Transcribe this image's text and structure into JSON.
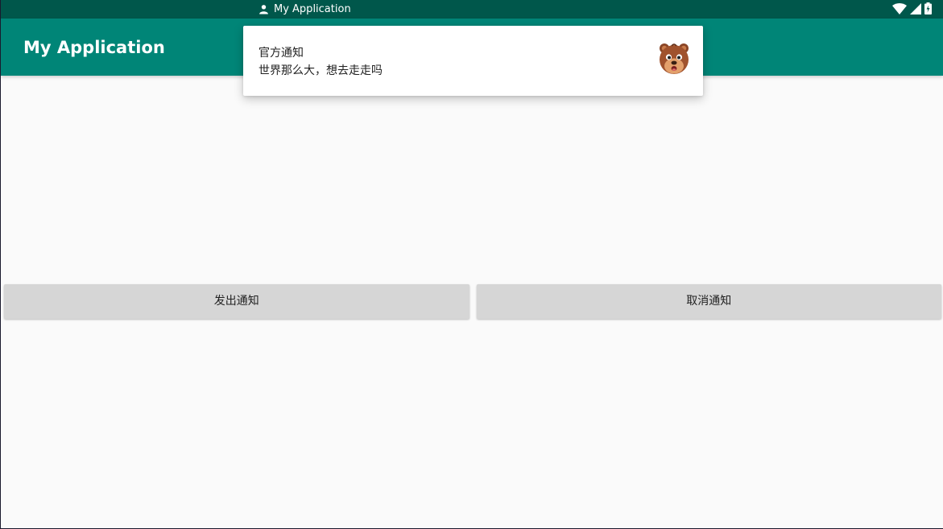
{
  "status_bar": {
    "notification_app_name": "My Application",
    "icons": [
      "person-icon",
      "wifi-icon",
      "cell-signal-icon",
      "battery-icon"
    ]
  },
  "app_bar": {
    "title": "My Application"
  },
  "notification": {
    "title": "官方通知",
    "text": "世界那么大，想去走走吗",
    "icon": "bear-face-icon"
  },
  "buttons": {
    "send_label": "发出通知",
    "cancel_label": "取消通知"
  },
  "colors": {
    "status_bar": "#00574b",
    "app_bar": "#008577",
    "background": "#fafafa",
    "button": "#d6d6d6"
  }
}
